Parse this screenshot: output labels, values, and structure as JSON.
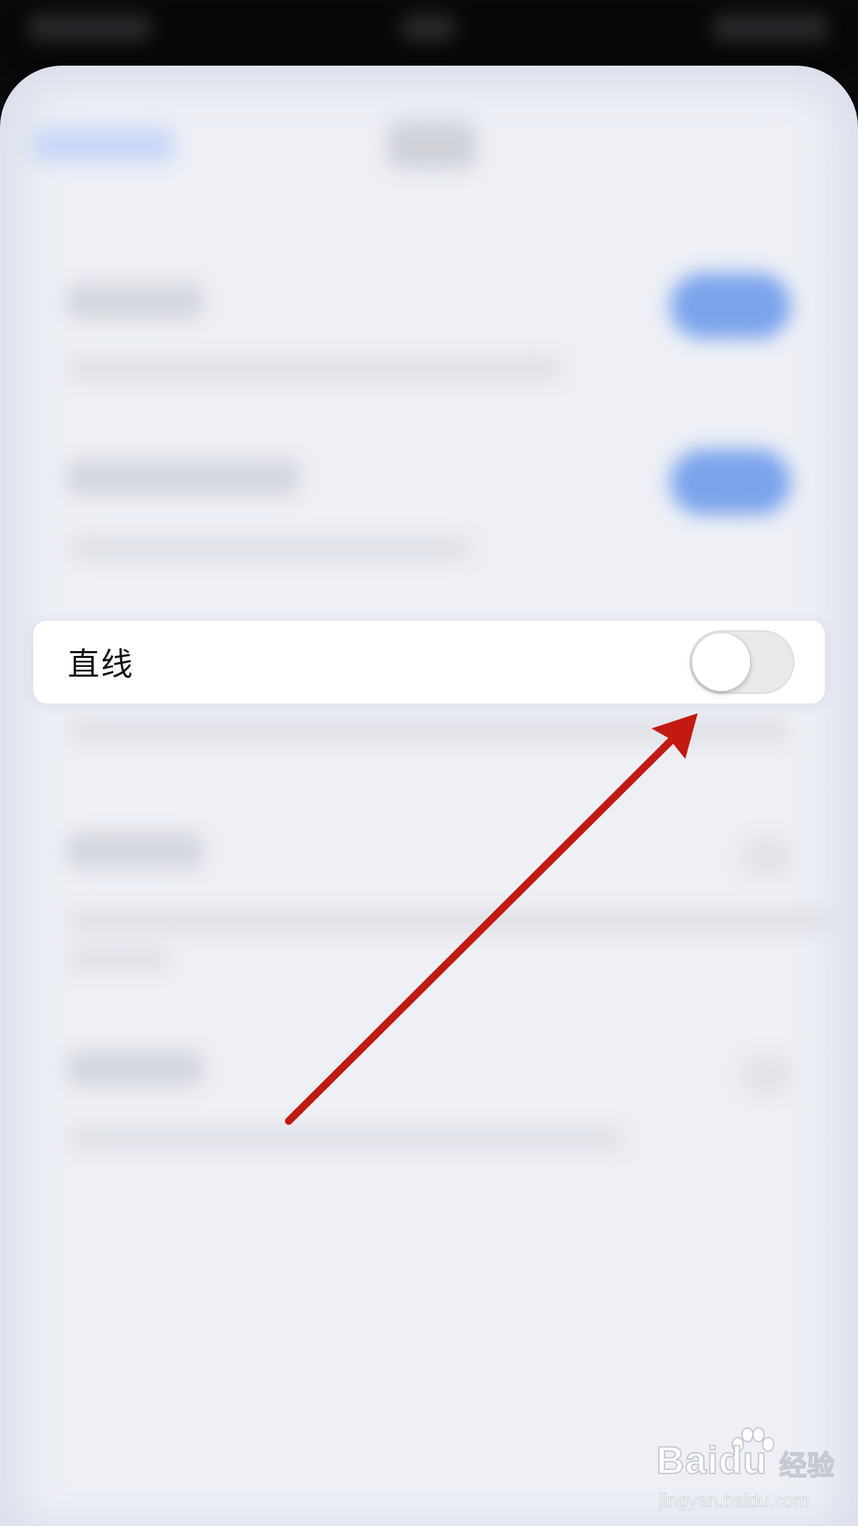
{
  "setting_row": {
    "label": "直线",
    "toggle_state": "off"
  },
  "annotation": {
    "arrow_color": "#c21a12",
    "points_to": "toggle"
  },
  "watermark": {
    "brand": "Baidu",
    "brand_cn": "经验",
    "url": "jingyan.baidu.com"
  },
  "colors": {
    "sheet_background": "#eef0f6",
    "toggle_on_blue": "#7aa3ec",
    "toggle_off": "#e9e9eb"
  }
}
